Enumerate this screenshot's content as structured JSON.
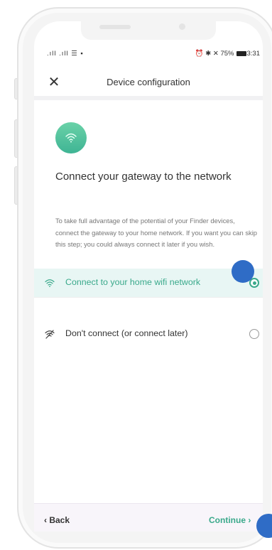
{
  "status_bar": {
    "left": ".ıll .ıll ☰ ▪",
    "right_icons": "⏰ ✱ ✕",
    "battery_pct": "75%",
    "time": "3:31"
  },
  "appbar": {
    "close_icon": "close-icon",
    "title": "Device configuration"
  },
  "main": {
    "heading": "Connect your gateway to the network",
    "description": "To take full advantage of the potential of your Finder devices, connect the gateway to your home network. If you want you can skip this step; you could always connect it later if you wish.",
    "options": [
      {
        "label": "Connect to your home wifi network",
        "icon": "wifi-icon",
        "selected": true
      },
      {
        "label": "Don't connect (or connect later)",
        "icon": "wifi-off-icon",
        "selected": false
      }
    ]
  },
  "footer": {
    "back_label": "Back",
    "continue_label": "Continue"
  },
  "colors": {
    "accent": "#3aa98b",
    "selected_row_bg": "#e8f6f4",
    "touch_indicator": "#2f6cc6"
  }
}
